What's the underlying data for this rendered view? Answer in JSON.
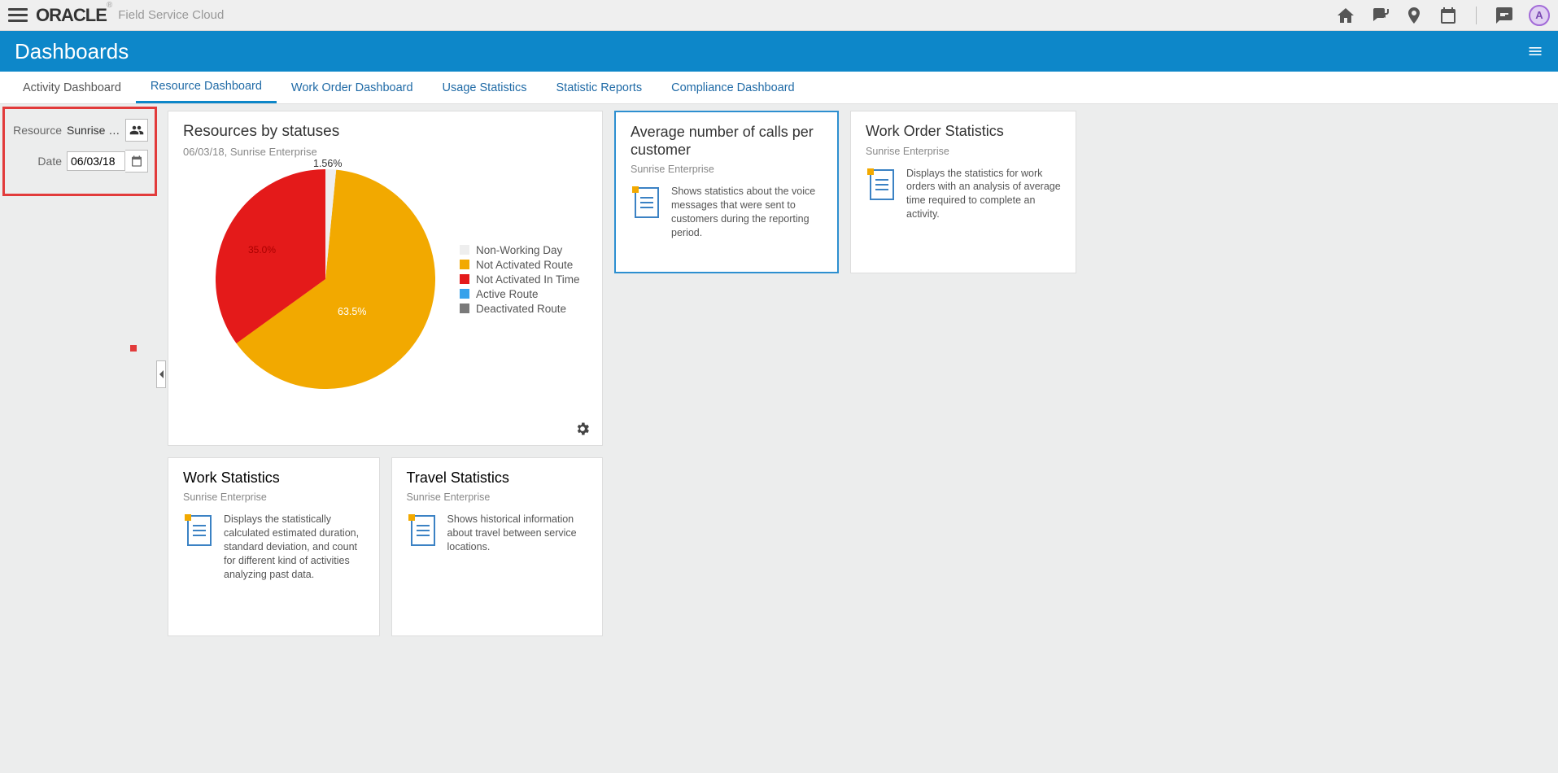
{
  "header": {
    "product": "Field Service Cloud",
    "avatar_letter": "A"
  },
  "banner": {
    "title": "Dashboards"
  },
  "tabs": [
    {
      "label": "Activity Dashboard",
      "active": false
    },
    {
      "label": "Resource Dashboard",
      "active": true
    },
    {
      "label": "Work Order Dashboard",
      "active": false
    },
    {
      "label": "Usage Statistics",
      "active": false
    },
    {
      "label": "Statistic Reports",
      "active": false
    },
    {
      "label": "Compliance Dashboard",
      "active": false
    }
  ],
  "filters": {
    "resource_label": "Resource",
    "resource_value": "Sunrise E...",
    "date_label": "Date",
    "date_value": "06/03/18"
  },
  "resources_card": {
    "title": "Resources by statuses",
    "subtitle": "06/03/18, Sunrise Enterprise"
  },
  "chart_data": {
    "type": "pie",
    "title": "Resources by statuses",
    "series": [
      {
        "name": "Non-Working Day",
        "value": 1.56,
        "color": "#eeeeee"
      },
      {
        "name": "Not Activated Route",
        "value": 63.5,
        "color": "#f2a900"
      },
      {
        "name": "Not Activated In Time",
        "value": 35.0,
        "color": "#e41a1a"
      },
      {
        "name": "Active Route",
        "value": 0.0,
        "color": "#36a2eb"
      },
      {
        "name": "Deactivated Route",
        "value": 0.0,
        "color": "#7a7a7a"
      }
    ],
    "labels_visible": [
      "1.56%",
      "63.5%",
      "35.0%"
    ]
  },
  "cards": {
    "avg_calls": {
      "title": "Average number of calls per customer",
      "sub": "Sunrise Enterprise",
      "desc": "Shows statistics about the voice messages that were sent to customers during the reporting period."
    },
    "work_order": {
      "title": "Work Order Statistics",
      "sub": "Sunrise Enterprise",
      "desc": "Displays the statistics for work orders with an analysis of average time required to complete an activity."
    },
    "work_stats": {
      "title": "Work Statistics",
      "sub": "Sunrise Enterprise",
      "desc": "Displays the statistically calculated estimated duration, standard deviation, and count for different kind of activities analyzing past data."
    },
    "travel_stats": {
      "title": "Travel Statistics",
      "sub": "Sunrise Enterprise",
      "desc": "Shows historical information about travel between service locations."
    }
  }
}
